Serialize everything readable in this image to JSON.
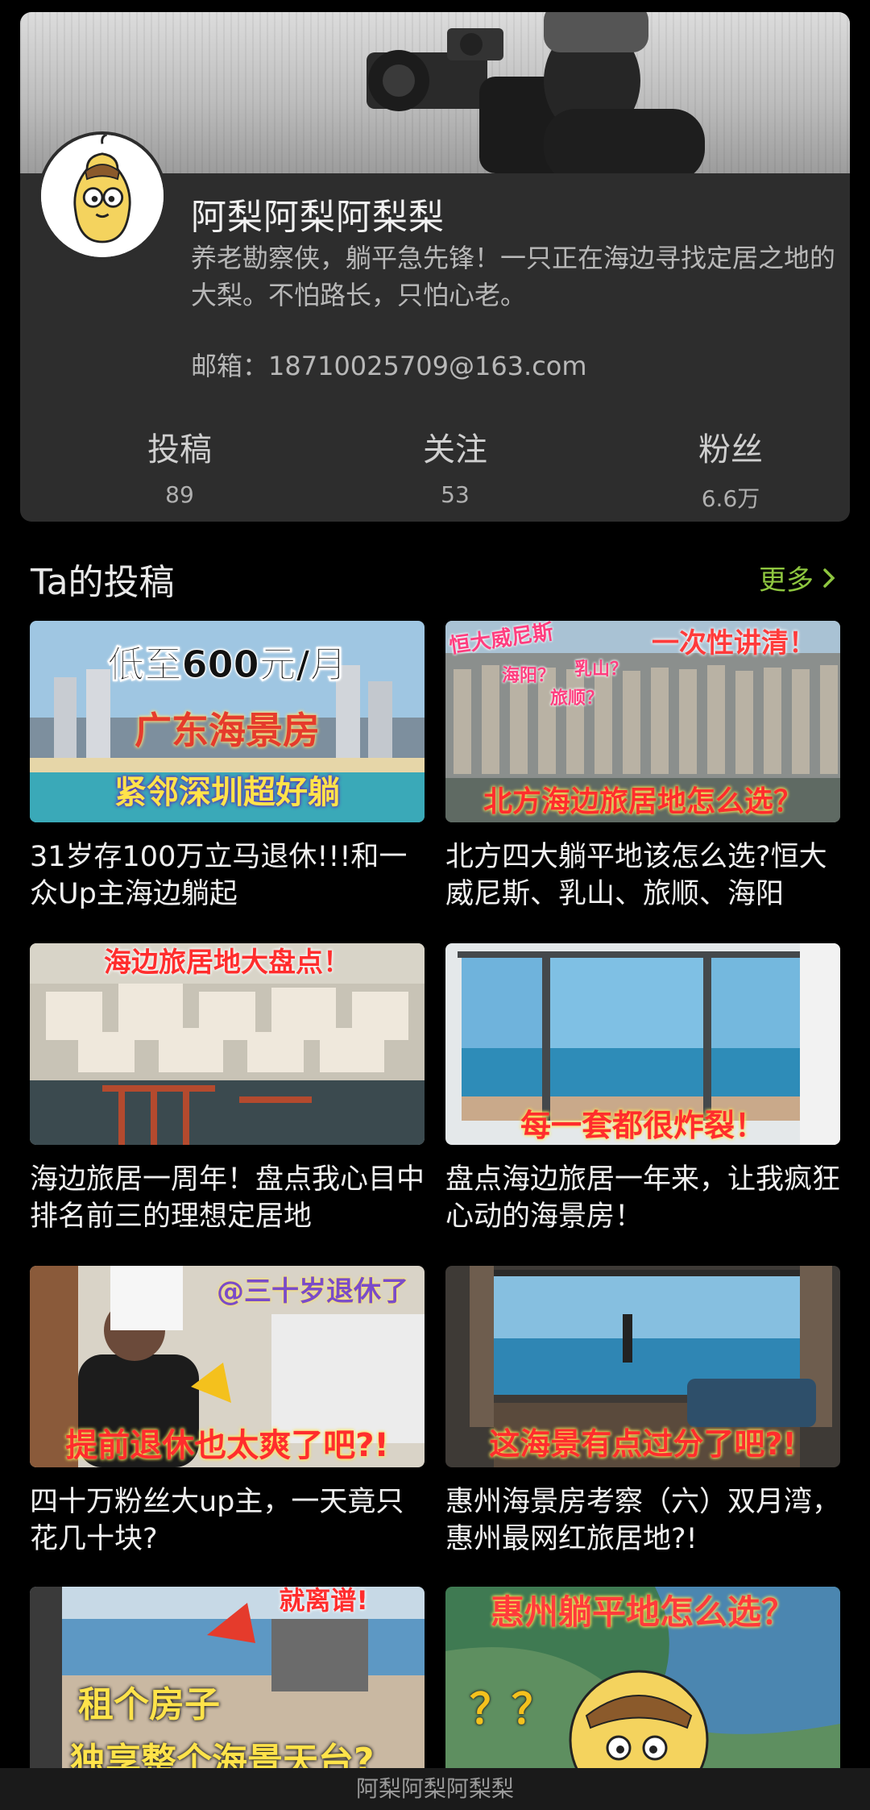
{
  "profile": {
    "name": "阿梨阿梨阿梨梨",
    "bio": "养老勘察侠，躺平急先锋！一只正在海边寻找定居之地的大梨。不怕路长，只怕心老。",
    "email": "邮箱：18710025709@163.com",
    "stats": [
      {
        "label": "投稿",
        "value": "89"
      },
      {
        "label": "关注",
        "value": "53"
      },
      {
        "label": "粉丝",
        "value": "6.6万"
      }
    ]
  },
  "section": {
    "title": "Ta的投稿",
    "more": "更多",
    "more_icon": "chevron-right-icon"
  },
  "videos": [
    {
      "title": "31岁存100万立马退休!!!和一众Up主海边躺起",
      "overlay": [
        "低至600元/月",
        "广东海景房",
        "紧邻深圳超好躺"
      ]
    },
    {
      "title": "北方四大躺平地该怎么选?恒大威尼斯、乳山、旅顺、海阳",
      "overlay": [
        "恒大威尼斯",
        "一次性讲清！",
        "乳山？",
        "海阳？",
        "旅顺？",
        "北方海边旅居地怎么选？"
      ]
    },
    {
      "title": "海边旅居一周年！盘点我心目中排名前三的理想定居地",
      "overlay": [
        "海边旅居地大盘点！"
      ]
    },
    {
      "title": "盘点海边旅居一年来，让我疯狂心动的海景房！",
      "overlay": [
        "每一套都很炸裂！"
      ]
    },
    {
      "title": "四十万粉丝大up主，一天竟只花几十块?",
      "overlay": [
        "@三十岁退休了",
        "提前退休也太爽了吧?!"
      ]
    },
    {
      "title": "惠州海景房考察（六）双月湾，惠州最网红旅居地?!",
      "overlay": [
        "这海景有点过分了吧?!"
      ]
    },
    {
      "title": "",
      "overlay": [
        "就离谱!",
        "租个房子",
        "独享整个海景天台?"
      ]
    },
    {
      "title": "",
      "overlay": [
        "惠州躺平地怎么选？",
        "？？"
      ]
    }
  ],
  "bottom_bar": {
    "label": "阿梨阿梨阿梨梨"
  }
}
